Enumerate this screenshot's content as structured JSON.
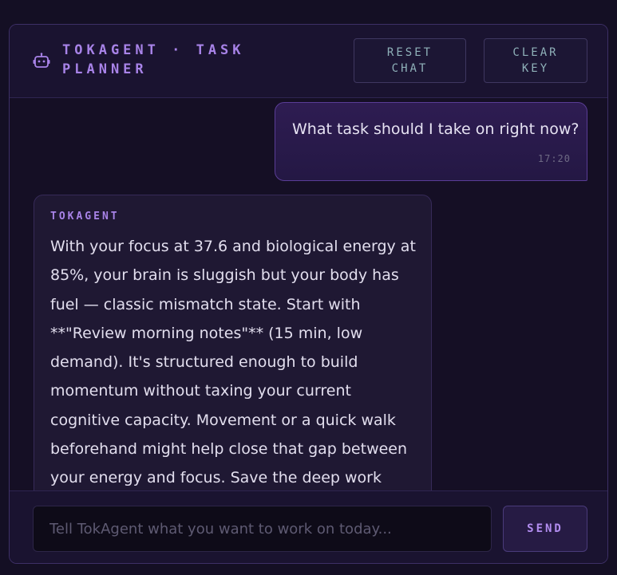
{
  "header": {
    "title": "TOKAGENT · TASK PLANNER",
    "icon": "robot-icon",
    "reset_button": "RESET CHAT",
    "clear_key_button": "CLEAR KEY"
  },
  "messages": [
    {
      "role": "user",
      "text": "What task should I take on right now?",
      "time": "17:20"
    },
    {
      "role": "agent",
      "sender": "TOKAGENT",
      "text": "With your focus at 37.6 and biological energy at 85%, your brain is sluggish but your body has fuel — classic mismatch state. Start with **\"Review morning notes\"** (15 min, low demand). It's structured enough to build momentum without taxing your current cognitive capacity. Movement or a quick walk beforehand might help close that gap between your energy and focus. Save the deep work block for when your focus climbs"
    }
  ],
  "composer": {
    "placeholder": "Tell TokAgent what you want to work on today...",
    "value": "",
    "send_button": "SEND"
  },
  "colors": {
    "accent": "#a883e8",
    "background": "#140f24",
    "user_bubble": "#2e1c52",
    "agent_bubble": "#1f1833"
  }
}
